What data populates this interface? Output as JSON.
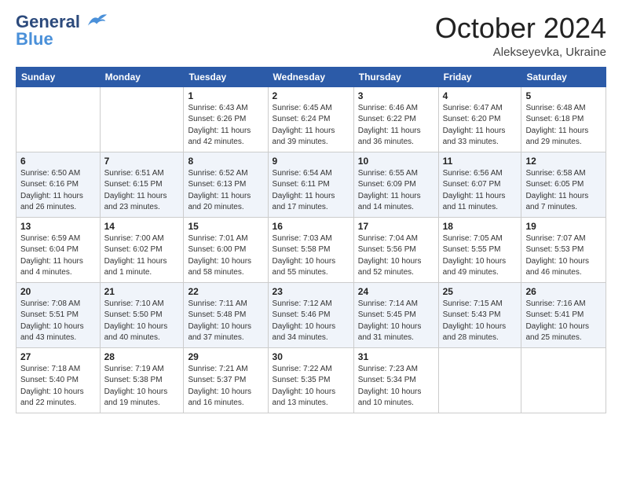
{
  "header": {
    "logo_line1": "General",
    "logo_line2": "Blue",
    "month_title": "October 2024",
    "location": "Alekseyevka, Ukraine"
  },
  "weekdays": [
    "Sunday",
    "Monday",
    "Tuesday",
    "Wednesday",
    "Thursday",
    "Friday",
    "Saturday"
  ],
  "weeks": [
    [
      {
        "day": "",
        "info": ""
      },
      {
        "day": "",
        "info": ""
      },
      {
        "day": "1",
        "info": "Sunrise: 6:43 AM\nSunset: 6:26 PM\nDaylight: 11 hours and 42 minutes."
      },
      {
        "day": "2",
        "info": "Sunrise: 6:45 AM\nSunset: 6:24 PM\nDaylight: 11 hours and 39 minutes."
      },
      {
        "day": "3",
        "info": "Sunrise: 6:46 AM\nSunset: 6:22 PM\nDaylight: 11 hours and 36 minutes."
      },
      {
        "day": "4",
        "info": "Sunrise: 6:47 AM\nSunset: 6:20 PM\nDaylight: 11 hours and 33 minutes."
      },
      {
        "day": "5",
        "info": "Sunrise: 6:48 AM\nSunset: 6:18 PM\nDaylight: 11 hours and 29 minutes."
      }
    ],
    [
      {
        "day": "6",
        "info": "Sunrise: 6:50 AM\nSunset: 6:16 PM\nDaylight: 11 hours and 26 minutes."
      },
      {
        "day": "7",
        "info": "Sunrise: 6:51 AM\nSunset: 6:15 PM\nDaylight: 11 hours and 23 minutes."
      },
      {
        "day": "8",
        "info": "Sunrise: 6:52 AM\nSunset: 6:13 PM\nDaylight: 11 hours and 20 minutes."
      },
      {
        "day": "9",
        "info": "Sunrise: 6:54 AM\nSunset: 6:11 PM\nDaylight: 11 hours and 17 minutes."
      },
      {
        "day": "10",
        "info": "Sunrise: 6:55 AM\nSunset: 6:09 PM\nDaylight: 11 hours and 14 minutes."
      },
      {
        "day": "11",
        "info": "Sunrise: 6:56 AM\nSunset: 6:07 PM\nDaylight: 11 hours and 11 minutes."
      },
      {
        "day": "12",
        "info": "Sunrise: 6:58 AM\nSunset: 6:05 PM\nDaylight: 11 hours and 7 minutes."
      }
    ],
    [
      {
        "day": "13",
        "info": "Sunrise: 6:59 AM\nSunset: 6:04 PM\nDaylight: 11 hours and 4 minutes."
      },
      {
        "day": "14",
        "info": "Sunrise: 7:00 AM\nSunset: 6:02 PM\nDaylight: 11 hours and 1 minute."
      },
      {
        "day": "15",
        "info": "Sunrise: 7:01 AM\nSunset: 6:00 PM\nDaylight: 10 hours and 58 minutes."
      },
      {
        "day": "16",
        "info": "Sunrise: 7:03 AM\nSunset: 5:58 PM\nDaylight: 10 hours and 55 minutes."
      },
      {
        "day": "17",
        "info": "Sunrise: 7:04 AM\nSunset: 5:56 PM\nDaylight: 10 hours and 52 minutes."
      },
      {
        "day": "18",
        "info": "Sunrise: 7:05 AM\nSunset: 5:55 PM\nDaylight: 10 hours and 49 minutes."
      },
      {
        "day": "19",
        "info": "Sunrise: 7:07 AM\nSunset: 5:53 PM\nDaylight: 10 hours and 46 minutes."
      }
    ],
    [
      {
        "day": "20",
        "info": "Sunrise: 7:08 AM\nSunset: 5:51 PM\nDaylight: 10 hours and 43 minutes."
      },
      {
        "day": "21",
        "info": "Sunrise: 7:10 AM\nSunset: 5:50 PM\nDaylight: 10 hours and 40 minutes."
      },
      {
        "day": "22",
        "info": "Sunrise: 7:11 AM\nSunset: 5:48 PM\nDaylight: 10 hours and 37 minutes."
      },
      {
        "day": "23",
        "info": "Sunrise: 7:12 AM\nSunset: 5:46 PM\nDaylight: 10 hours and 34 minutes."
      },
      {
        "day": "24",
        "info": "Sunrise: 7:14 AM\nSunset: 5:45 PM\nDaylight: 10 hours and 31 minutes."
      },
      {
        "day": "25",
        "info": "Sunrise: 7:15 AM\nSunset: 5:43 PM\nDaylight: 10 hours and 28 minutes."
      },
      {
        "day": "26",
        "info": "Sunrise: 7:16 AM\nSunset: 5:41 PM\nDaylight: 10 hours and 25 minutes."
      }
    ],
    [
      {
        "day": "27",
        "info": "Sunrise: 7:18 AM\nSunset: 5:40 PM\nDaylight: 10 hours and 22 minutes."
      },
      {
        "day": "28",
        "info": "Sunrise: 7:19 AM\nSunset: 5:38 PM\nDaylight: 10 hours and 19 minutes."
      },
      {
        "day": "29",
        "info": "Sunrise: 7:21 AM\nSunset: 5:37 PM\nDaylight: 10 hours and 16 minutes."
      },
      {
        "day": "30",
        "info": "Sunrise: 7:22 AM\nSunset: 5:35 PM\nDaylight: 10 hours and 13 minutes."
      },
      {
        "day": "31",
        "info": "Sunrise: 7:23 AM\nSunset: 5:34 PM\nDaylight: 10 hours and 10 minutes."
      },
      {
        "day": "",
        "info": ""
      },
      {
        "day": "",
        "info": ""
      }
    ]
  ]
}
